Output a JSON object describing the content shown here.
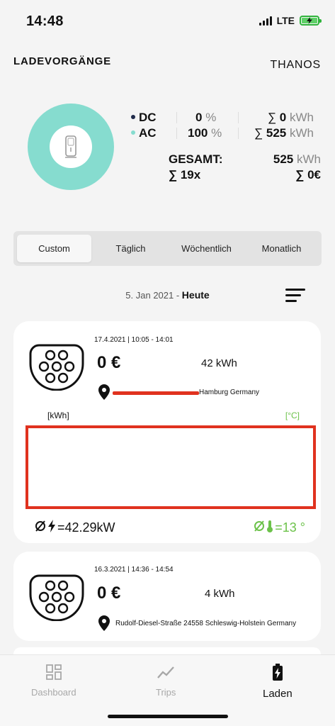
{
  "status": {
    "time": "14:48",
    "network": "LTE"
  },
  "header": {
    "title": "LADEVORGÄNGE",
    "user": "THANOS"
  },
  "summary": {
    "dc": {
      "label": "DC",
      "count": "0",
      "pct": "%",
      "energy_prefix": "∑",
      "energy": "0",
      "unit": "kWh",
      "color": "#1f2a4a"
    },
    "ac": {
      "label": "AC",
      "count": "100",
      "pct": "%",
      "energy_prefix": "∑",
      "energy": "525",
      "unit": "kWh",
      "color": "#86dccf"
    },
    "total_label": "GESAMT:",
    "total_energy": "525",
    "total_unit": "kWh",
    "count_text": "∑ 19x",
    "cost_text": "∑ 0€"
  },
  "segments": [
    "Custom",
    "Täglich",
    "Wöchentlich",
    "Monatlich"
  ],
  "selected_segment": "Custom",
  "date_filter": {
    "date": "5. Jan 2021 - ",
    "label": "Heute"
  },
  "sessions": [
    {
      "datetime": "17.4.2021 | 10:05 - 14:01",
      "price": "0 €",
      "energy": "42 kWh",
      "address": "Hamburg Germany",
      "chart_left_label": "[kWh]",
      "chart_right_label": "[°C]",
      "avg_power": "=42.29kW",
      "avg_temp": "=13 °"
    },
    {
      "datetime": "16.3.2021 | 14:36 - 14:54",
      "price": "0 €",
      "energy": "4 kWh",
      "address": "Rudolf-Diesel-Straße 24558 Schleswig-Holstein Germany"
    }
  ],
  "tabs": [
    {
      "label": "Dashboard",
      "icon": "dashboard-icon"
    },
    {
      "label": "Trips",
      "icon": "trips-icon"
    },
    {
      "label": "Laden",
      "icon": "charging-icon"
    }
  ],
  "colors": {
    "accent_teal": "#86dccf",
    "highlight_red": "#e0321f",
    "temp_green": "#6cc24a"
  }
}
